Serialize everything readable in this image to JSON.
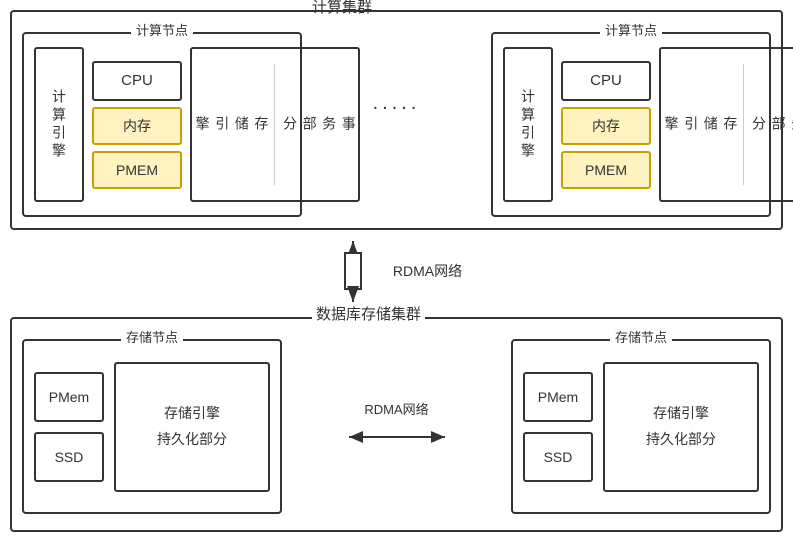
{
  "compute_cluster": {
    "label": "计算集群",
    "dots": ".....",
    "node_left": {
      "label": "计算节点",
      "engine": "计\n算\n引\n擎",
      "cpu": "CPU",
      "mem": "内存",
      "pmem": "PMEM",
      "storage_col1": "存\n储\n引\n擎",
      "storage_col2": "事\n务\n部\n分"
    },
    "node_right": {
      "label": "计算节点",
      "engine": "计\n算\n引\n擎",
      "cpu": "CPU",
      "mem": "内存",
      "pmem": "PMEM",
      "storage_col1": "存\n储\n引\n擎",
      "storage_col2": "事\n务\n部\n分"
    }
  },
  "rdma_top": {
    "label": "RDMA网络"
  },
  "storage_cluster": {
    "label": "数据库存储集群",
    "rdma_middle_label": "RDMA网络",
    "node_left": {
      "label": "存储节点",
      "pmem": "PMem",
      "ssd": "SSD",
      "engine": "存储引擎\n持久化部分"
    },
    "node_right": {
      "label": "存储节点",
      "pmem": "PMem",
      "ssd": "SSD",
      "engine": "存储引擎\n持久化部分"
    }
  }
}
